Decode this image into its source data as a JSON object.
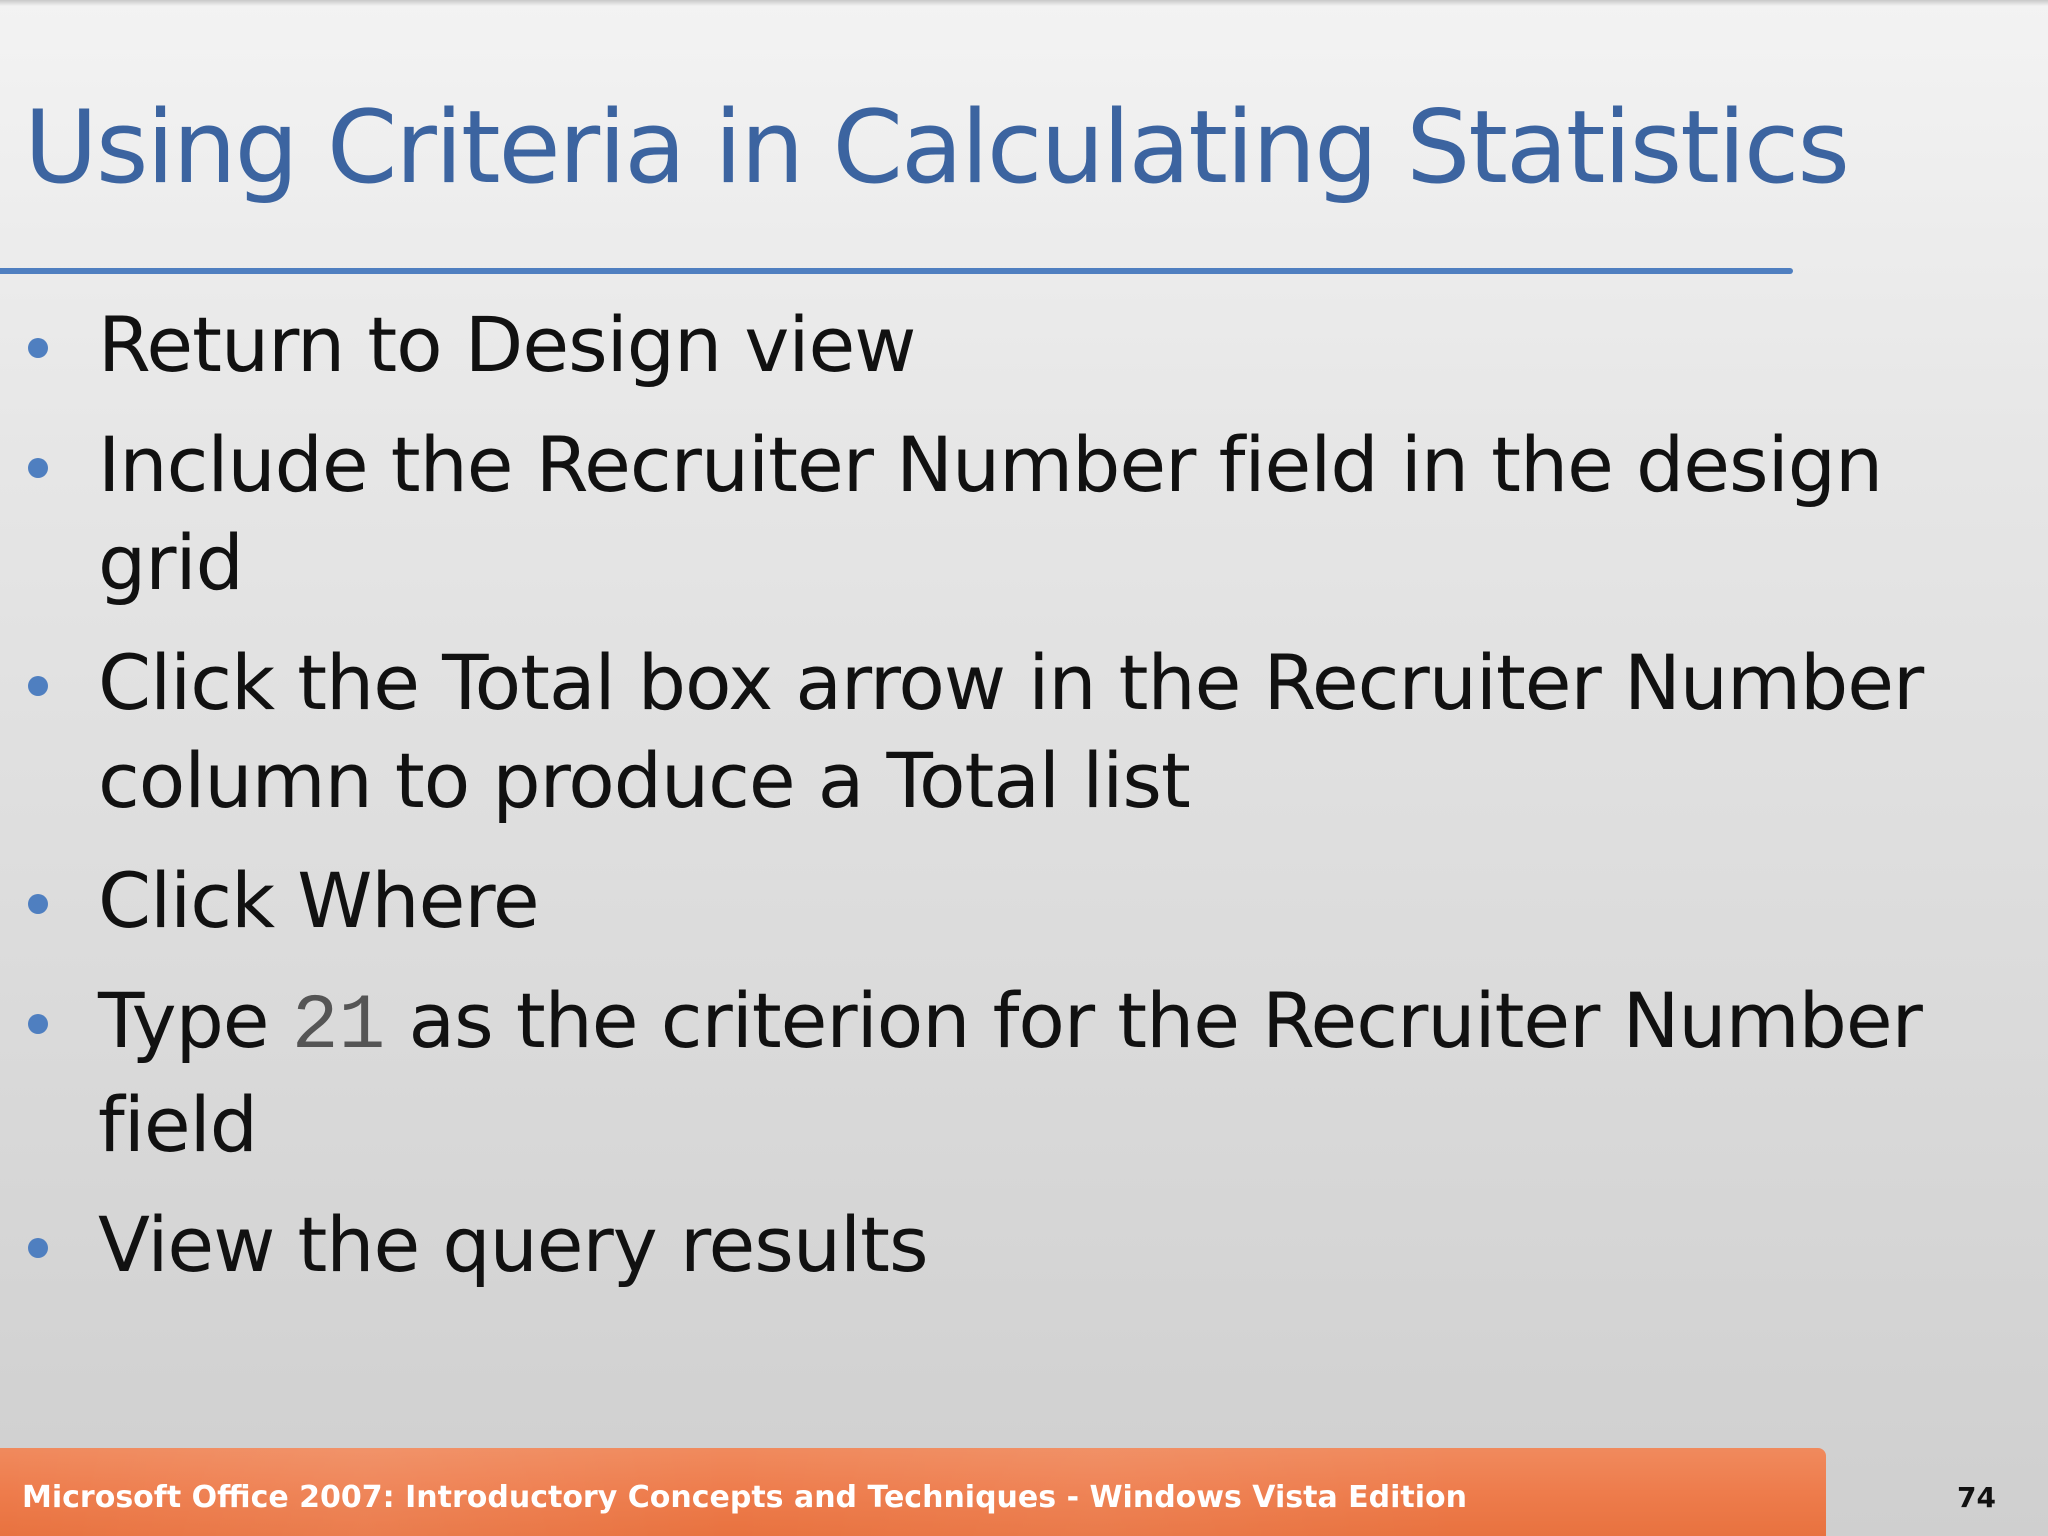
{
  "slide": {
    "title": "Using Criteria in Calculating Statistics",
    "bullets": [
      {
        "text": "Return to Design view"
      },
      {
        "text": "Include the Recruiter Number field in the design grid"
      },
      {
        "text": "Click the Total box arrow in the Recruiter Number column to produce a Total list"
      },
      {
        "text": "Click Where"
      },
      {
        "pre": "Type ",
        "code": "21",
        "post": " as the criterion for the Recruiter Number field"
      },
      {
        "text": "View the query results"
      }
    ],
    "accent_color": "#4f7fc0",
    "title_color": "#3c64a0"
  },
  "footer": {
    "text": "Microsoft Office 2007: Introductory Concepts and Techniques - Windows Vista Edition",
    "page_number": "74",
    "bar_color": "#ee7c4c"
  }
}
